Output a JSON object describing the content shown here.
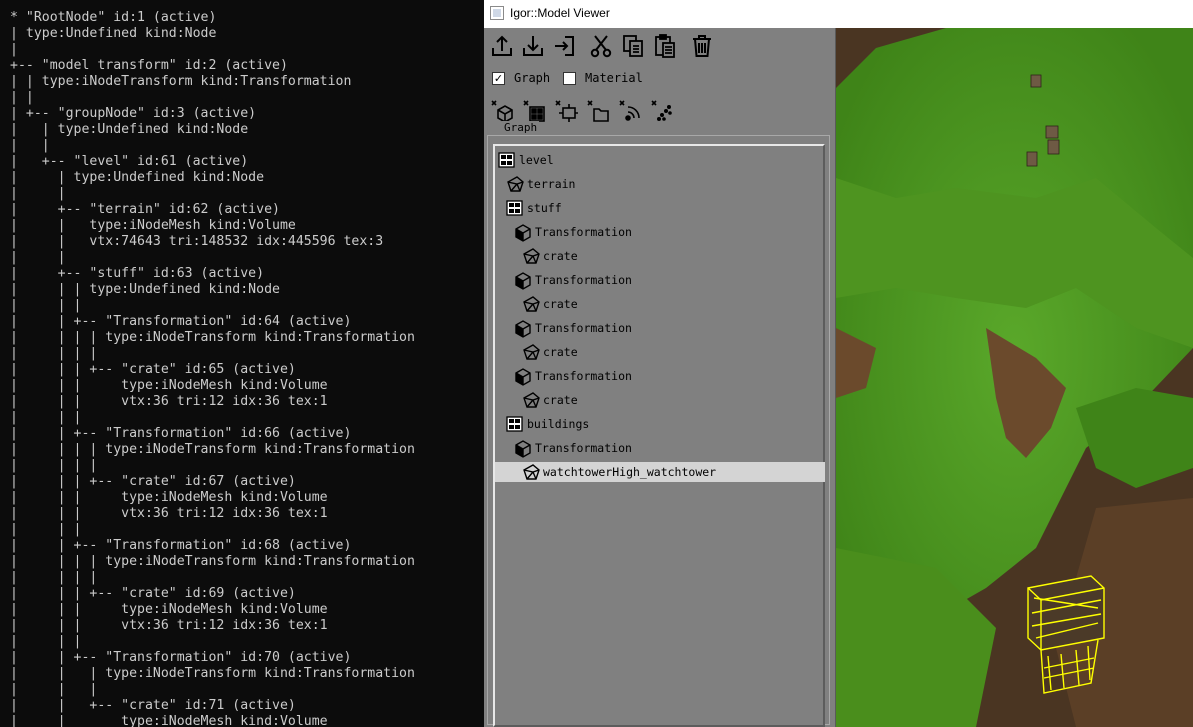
{
  "console": {
    "lines": [
      "* \"RootNode\" id:1 (active)",
      "| type:Undefined kind:Node",
      "|",
      "+-- \"model transform\" id:2 (active)",
      "| | type:iNodeTransform kind:Transformation",
      "| |",
      "| +-- \"groupNode\" id:3 (active)",
      "|   | type:Undefined kind:Node",
      "|   |",
      "|   +-- \"level\" id:61 (active)",
      "|     | type:Undefined kind:Node",
      "|     |",
      "|     +-- \"terrain\" id:62 (active)",
      "|     |   type:iNodeMesh kind:Volume",
      "|     |   vtx:74643 tri:148532 idx:445596 tex:3",
      "|     |",
      "|     +-- \"stuff\" id:63 (active)",
      "|     | | type:Undefined kind:Node",
      "|     | |",
      "|     | +-- \"Transformation\" id:64 (active)",
      "|     | | | type:iNodeTransform kind:Transformation",
      "|     | | |",
      "|     | | +-- \"crate\" id:65 (active)",
      "|     | |     type:iNodeMesh kind:Volume",
      "|     | |     vtx:36 tri:12 idx:36 tex:1",
      "|     | |",
      "|     | +-- \"Transformation\" id:66 (active)",
      "|     | | | type:iNodeTransform kind:Transformation",
      "|     | | |",
      "|     | | +-- \"crate\" id:67 (active)",
      "|     | |     type:iNodeMesh kind:Volume",
      "|     | |     vtx:36 tri:12 idx:36 tex:1",
      "|     | |",
      "|     | +-- \"Transformation\" id:68 (active)",
      "|     | | | type:iNodeTransform kind:Transformation",
      "|     | | |",
      "|     | | +-- \"crate\" id:69 (active)",
      "|     | |     type:iNodeMesh kind:Volume",
      "|     | |     vtx:36 tri:12 idx:36 tex:1",
      "|     | |",
      "|     | +-- \"Transformation\" id:70 (active)",
      "|     |   | type:iNodeTransform kind:Transformation",
      "|     |   |",
      "|     |   +-- \"crate\" id:71 (active)",
      "|     |       type:iNodeMesh kind:Volume"
    ]
  },
  "window": {
    "title": "Igor::Model Viewer"
  },
  "toolbar": {
    "buttons": [
      "load-icon",
      "save-icon",
      "import-icon",
      "cut-icon",
      "copy-icon",
      "paste-icon",
      "delete-icon"
    ]
  },
  "view_options": {
    "graph": {
      "label": "Graph",
      "checked": true,
      "mark": "✓"
    },
    "material": {
      "label": "Material",
      "checked": false
    }
  },
  "node_buttons": [
    "add-transform-icon",
    "add-group-icon",
    "add-switch-icon",
    "add-model-icon",
    "add-emitter-icon",
    "add-particles-icon"
  ],
  "graph_group": {
    "title": "Graph"
  },
  "tree": {
    "nodes": [
      {
        "label": "level",
        "icon": "group-node-icon",
        "depth": 0,
        "selected": false
      },
      {
        "label": "terrain",
        "icon": "mesh-node-icon",
        "depth": 1,
        "selected": false
      },
      {
        "label": "stuff",
        "icon": "group-node-icon",
        "depth": 1,
        "selected": false
      },
      {
        "label": "Transformation",
        "icon": "transform-node-icon",
        "depth": 2,
        "selected": false
      },
      {
        "label": "crate",
        "icon": "mesh-node-icon",
        "depth": 3,
        "selected": false
      },
      {
        "label": "Transformation",
        "icon": "transform-node-icon",
        "depth": 2,
        "selected": false
      },
      {
        "label": "crate",
        "icon": "mesh-node-icon",
        "depth": 3,
        "selected": false
      },
      {
        "label": "Transformation",
        "icon": "transform-node-icon",
        "depth": 2,
        "selected": false
      },
      {
        "label": "crate",
        "icon": "mesh-node-icon",
        "depth": 3,
        "selected": false
      },
      {
        "label": "Transformation",
        "icon": "transform-node-icon",
        "depth": 2,
        "selected": false
      },
      {
        "label": "crate",
        "icon": "mesh-node-icon",
        "depth": 3,
        "selected": false
      },
      {
        "label": "buildings",
        "icon": "group-node-icon",
        "depth": 1,
        "selected": false
      },
      {
        "label": "Transformation",
        "icon": "transform-node-icon",
        "depth": 2,
        "selected": false
      },
      {
        "label": "watchtowerHigh_watchtower",
        "icon": "mesh-node-icon",
        "depth": 3,
        "selected": true
      }
    ]
  },
  "colors": {
    "console_bg": "#0c0c0c",
    "console_text": "#cccccc",
    "panel_bg": "#808080",
    "selection": "#d4d4d4",
    "wireframe_highlight": "#ffff00",
    "terrain_grass": "#4c9a1c"
  }
}
